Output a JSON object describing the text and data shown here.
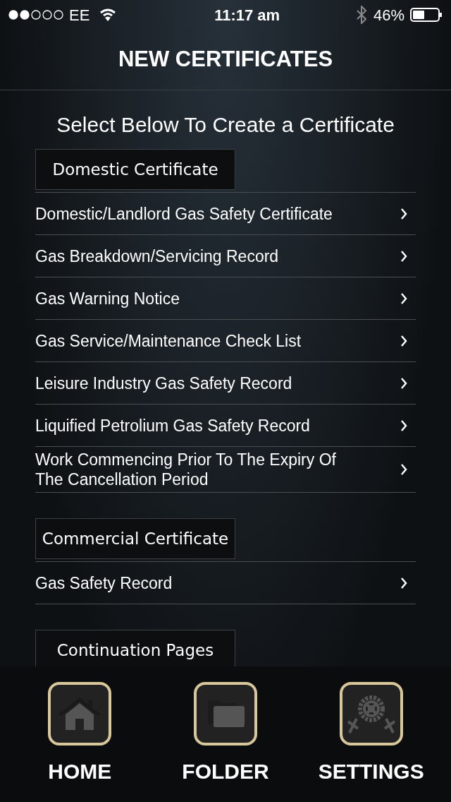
{
  "status_bar": {
    "carrier": "EE",
    "time": "11:17 am",
    "battery": "46%"
  },
  "title": "NEW CERTIFICATES",
  "heading": "Select Below To Create a Certificate",
  "sections": [
    {
      "title": "Domestic Certificate",
      "items": [
        "Domestic/Landlord Gas Safety Certificate",
        "Gas Breakdown/Servicing Record",
        "Gas Warning Notice",
        "Gas Service/Maintenance Check List",
        "Leisure Industry Gas Safety Record",
        "Liquified Petrolium Gas Safety Record",
        "Work Commencing Prior To The Expiry Of The Cancellation Period"
      ]
    },
    {
      "title": "Commercial Certificate",
      "items": [
        "Gas Safety Record"
      ]
    },
    {
      "title": "Continuation Pages"
    }
  ],
  "tab_bar": [
    {
      "kind": "home",
      "label": "HOME"
    },
    {
      "kind": "folder",
      "label": "FOLDER"
    },
    {
      "kind": "settings",
      "label": "SETTINGS"
    }
  ]
}
